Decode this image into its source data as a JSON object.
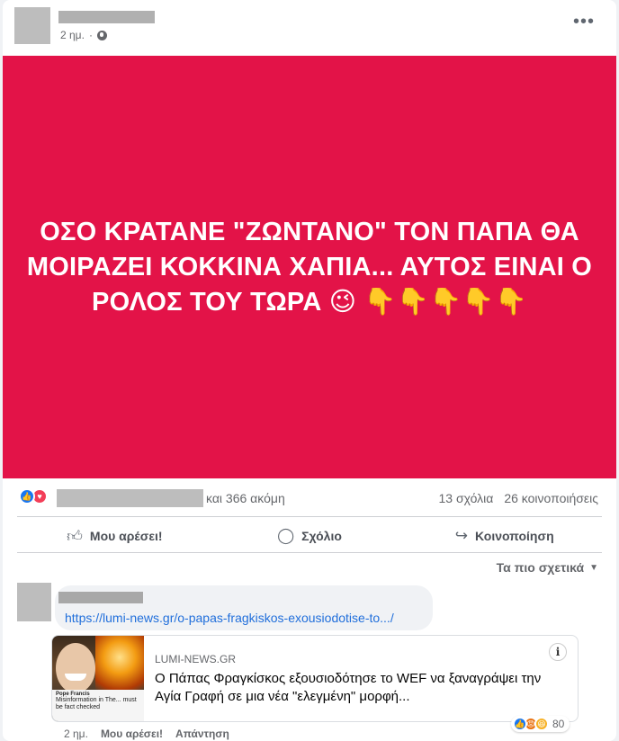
{
  "post": {
    "time": "2 ημ.",
    "more_label": "•••",
    "banner_text": "ΟΣΟ ΚΡΑΤΑΝΕ \"ΖΩΝΤΑΝΟ\" ΤΟΝ ΠΑΠΑ ΘΑ ΜΟΙΡΑΖΕΙ ΚΟΚΚΙΝΑ ΧΑΠΙΑ... ΑΥΤΟΣ ΕΙΝΑΙ Ο ΡΟΛΟΣ ΤΟΥ ΤΩΡΑ 😉 👇👇👇👇👇",
    "banner_color": "#e31348"
  },
  "stats": {
    "reactions_more": "και 366 ακόμη",
    "comments": "13 σχόλια",
    "shares": "26 κοινοποιήσεις"
  },
  "actions": {
    "like": "Μου αρέσει!",
    "comment": "Σχόλιο",
    "share": "Κοινοποίηση"
  },
  "sort": {
    "label": "Τα πιο σχετικά"
  },
  "comment": {
    "link": "https://lumi-news.gr/o-papas-fragkiskos-exousiodotise-to.../",
    "preview": {
      "domain": "LUMI-NEWS.GR",
      "title": "Ο Πάπας Φραγκίσκος εξουσιοδότησε το WEF να ξαναγράψει την Αγία Γραφή σε μια νέα \"ελεγμένη\" μορφή...",
      "thumb_tweet_name": "Pope Francis",
      "thumb_tweet_text": "Misinformation in The... must be fact checked"
    },
    "reaction_count": "80",
    "time": "2 ημ.",
    "like": "Μου αρέσει!",
    "reply": "Απάντηση"
  }
}
